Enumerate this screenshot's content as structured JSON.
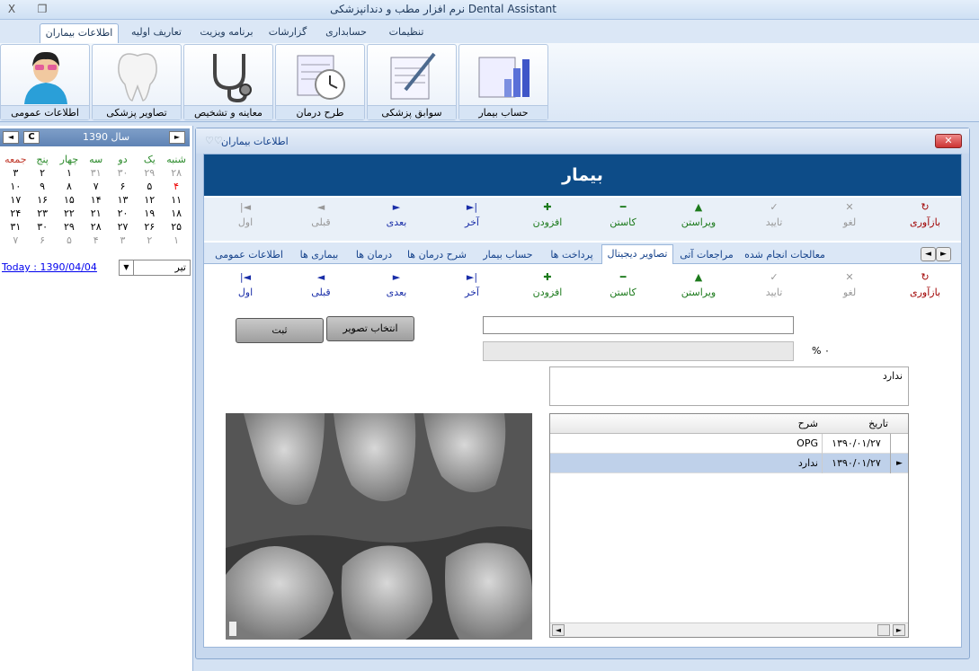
{
  "window": {
    "title": "نرم افزار مطب و دندانپزشکی Dental Assistant",
    "close_glyph": "X",
    "restore_glyph": "❐"
  },
  "menu": {
    "tabs": [
      {
        "label": "اطلاعات بیماران"
      },
      {
        "label": "تعاریف اولیه"
      },
      {
        "label": "برنامه ویزیت"
      },
      {
        "label": "گزارشات"
      },
      {
        "label": "حسابداری"
      },
      {
        "label": "تنظیمات"
      }
    ]
  },
  "ribbon": {
    "buttons": [
      {
        "label": "اطلاعات عمومی",
        "icon": "patient-avatar-icon"
      },
      {
        "label": "تصاویر پزشکی",
        "icon": "tooth-icon"
      },
      {
        "label": "معاینه و تشخیص",
        "icon": "stethoscope-icon"
      },
      {
        "label": "طرح درمان",
        "icon": "schedule-clock-icon"
      },
      {
        "label": "سوابق پزشکی",
        "icon": "document-pen-icon"
      },
      {
        "label": "حساب بیمار",
        "icon": "bar-chart-icon"
      }
    ]
  },
  "calendar": {
    "year_label": "سال 1390",
    "prev_glyph": "◄",
    "next_glyph": "►",
    "clear_label": "C",
    "day_headers": [
      "شنبه",
      "یک",
      "دو",
      "سه",
      "چهار",
      "پنج",
      "جمعه"
    ],
    "weeks": [
      [
        "۲۸",
        "۲۹",
        "۳۰",
        "۳۱",
        "۱",
        "۲",
        "۳"
      ],
      [
        "۴",
        "۵",
        "۶",
        "۷",
        "۸",
        "۹",
        "۱۰"
      ],
      [
        "۱۱",
        "۱۲",
        "۱۳",
        "۱۴",
        "۱۵",
        "۱۶",
        "۱۷"
      ],
      [
        "۱۸",
        "۱۹",
        "۲۰",
        "۲۱",
        "۲۲",
        "۲۳",
        "۲۴"
      ],
      [
        "۲۵",
        "۲۶",
        "۲۷",
        "۲۸",
        "۲۹",
        "۳۰",
        "۳۱"
      ],
      [
        "۱",
        "۲",
        "۳",
        "۴",
        "۵",
        "۶",
        "۷"
      ]
    ],
    "today_link": "Today : 1390/04/04",
    "month_value": "تیر",
    "colors": {
      "header_green": "#2a8a2a",
      "friday_red": "#c0392b",
      "selected_red": "#e00000",
      "dim": "#999999"
    }
  },
  "patient_window": {
    "title": "اطلاعات بیماران",
    "hearts": "♡♡",
    "close_glyph": "✕",
    "banner": "بیمار",
    "toolbar": [
      {
        "label": "بازآوری",
        "icon": "refresh-icon",
        "glyph": "↻",
        "color": "red"
      },
      {
        "label": "لغو",
        "icon": "cancel-icon",
        "glyph": "✕",
        "color": "gray"
      },
      {
        "label": "تایید",
        "icon": "confirm-icon",
        "glyph": "✓",
        "color": "gray"
      },
      {
        "label": "ویراستن",
        "icon": "edit-icon",
        "glyph": "▲",
        "color": "green"
      },
      {
        "label": "کاستن",
        "icon": "minus-icon",
        "glyph": "━",
        "color": "green"
      },
      {
        "label": "افزودن",
        "icon": "plus-icon",
        "glyph": "✚",
        "color": "green"
      },
      {
        "label": "آخر",
        "icon": "last-icon",
        "glyph": "►|",
        "color": "blue"
      },
      {
        "label": "بعدی",
        "icon": "next-icon",
        "glyph": "►",
        "color": "blue"
      },
      {
        "label": "قبلی",
        "icon": "prev-icon",
        "glyph": "◄",
        "color": "gray"
      },
      {
        "label": "اول",
        "icon": "first-icon",
        "glyph": "|◄",
        "color": "gray"
      }
    ],
    "subtabs": [
      {
        "label": "معالجات انجام شده"
      },
      {
        "label": "مراجعات آتی"
      },
      {
        "label": "تصاویر دیجیتال"
      },
      {
        "label": "پرداخت ها"
      },
      {
        "label": "حساب بیمار"
      },
      {
        "label": "شرح درمان ها"
      },
      {
        "label": "درمان ها"
      },
      {
        "label": "بیماری ها"
      },
      {
        "label": "اطلاعات عمومی"
      }
    ],
    "sub_toolbar": [
      {
        "label": "بازآوری",
        "icon": "refresh-icon",
        "glyph": "↻",
        "color": "red"
      },
      {
        "label": "لغو",
        "icon": "cancel-icon",
        "glyph": "✕",
        "color": "gray"
      },
      {
        "label": "تایید",
        "icon": "confirm-icon",
        "glyph": "✓",
        "color": "gray"
      },
      {
        "label": "ویراستن",
        "icon": "edit-icon",
        "glyph": "▲",
        "color": "green"
      },
      {
        "label": "کاستن",
        "icon": "minus-icon",
        "glyph": "━",
        "color": "green"
      },
      {
        "label": "افزودن",
        "icon": "plus-icon",
        "glyph": "✚",
        "color": "green"
      },
      {
        "label": "آخر",
        "icon": "last-icon",
        "glyph": "►|",
        "color": "blue"
      },
      {
        "label": "بعدی",
        "icon": "next-icon",
        "glyph": "►",
        "color": "blue"
      },
      {
        "label": "قبلی",
        "icon": "prev-icon",
        "glyph": "◄",
        "color": "blue"
      },
      {
        "label": "اول",
        "icon": "first-icon",
        "glyph": "|◄",
        "color": "blue"
      }
    ],
    "digital_images": {
      "path_value": "",
      "progress_label": "% ۰",
      "progress": 0,
      "select_image_button": "انتخاب تصویر",
      "save_button": "ثبت",
      "description_value": "ندارد",
      "grid": {
        "columns": [
          "تاریخ",
          "شرح"
        ],
        "rows": [
          {
            "date": "۱۳۹۰/۰۱/۲۷",
            "desc": "OPG",
            "selected": false
          },
          {
            "date": "۱۳۹۰/۰۱/۲۷",
            "desc": "ندارد",
            "selected": true
          }
        ],
        "current_row_glyph": "►"
      }
    }
  }
}
